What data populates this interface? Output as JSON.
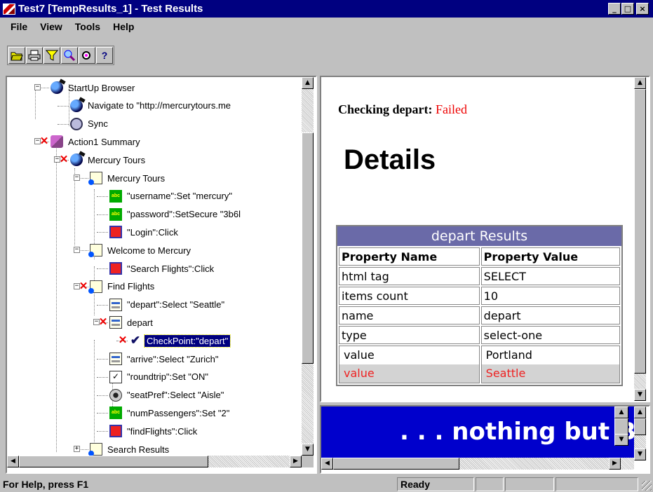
{
  "window": {
    "title": "Test7 [TempResults_1] - Test Results",
    "minimize": "_",
    "restore": "□",
    "close": "×"
  },
  "menu": [
    "File",
    "View",
    "Tools",
    "Help"
  ],
  "toolbar": {
    "help_label": "?",
    "icons": [
      "open-icon",
      "print-icon",
      "filter-icon",
      "find-icon",
      "goto-icon",
      "help-icon"
    ]
  },
  "tree": [
    {
      "label": "StartUp Browser",
      "icon": "globe",
      "level": 0,
      "expander": "−",
      "failed": false
    },
    {
      "label": "Navigate to  \"http://mercurytours.me",
      "icon": "globe",
      "level": 1,
      "failed": false
    },
    {
      "label": "Sync",
      "icon": "sync",
      "level": 1,
      "failed": false
    },
    {
      "label": "Action1 Summary",
      "icon": "action",
      "level": 0,
      "expander": "−",
      "failed": true
    },
    {
      "label": "Mercury Tours",
      "icon": "globe",
      "level": 1,
      "expander": "−",
      "failed": true
    },
    {
      "label": "Mercury Tours",
      "icon": "page",
      "level": 2,
      "expander": "−",
      "failed": false
    },
    {
      "label": "\"username\":Set \"mercury\"",
      "icon": "edit",
      "level": 3,
      "failed": false
    },
    {
      "label": "\"password\":SetSecure \"3b6l",
      "icon": "edit",
      "level": 3,
      "failed": false
    },
    {
      "label": "\"Login\":Click",
      "icon": "btn",
      "level": 3,
      "failed": false
    },
    {
      "label": "Welcome to Mercury",
      "icon": "page",
      "level": 2,
      "expander": "−",
      "failed": false
    },
    {
      "label": "\"Search Flights\":Click",
      "icon": "btn",
      "level": 3,
      "failed": false
    },
    {
      "label": "Find Flights",
      "icon": "page",
      "level": 2,
      "expander": "−",
      "failed": true
    },
    {
      "label": "\"depart\":Select \"Seattle\"",
      "icon": "list",
      "level": 3,
      "failed": false
    },
    {
      "label": "depart",
      "icon": "list",
      "level": 3,
      "expander": "−",
      "failed": true
    },
    {
      "label": "CheckPoint:\"depart\"",
      "icon": "check",
      "level": 4,
      "failed": true,
      "selected": true
    },
    {
      "label": "\"arrive\":Select \"Zurich\"",
      "icon": "list",
      "level": 3,
      "failed": false
    },
    {
      "label": "\"roundtrip\":Set \"ON\"",
      "icon": "checkbox",
      "level": 3,
      "failed": false
    },
    {
      "label": "\"seatPref\":Select \"Aisle\"",
      "icon": "radio",
      "level": 3,
      "failed": false
    },
    {
      "label": "\"numPassengers\":Set \"2\"",
      "icon": "edit",
      "level": 3,
      "failed": false
    },
    {
      "label": "\"findFlights\":Click",
      "icon": "btn",
      "level": 3,
      "failed": false
    },
    {
      "label": "Search Results",
      "icon": "page",
      "level": 2,
      "expander": "+",
      "failed": false
    }
  ],
  "details": {
    "checking_label": "Checking depart",
    "colon": ": ",
    "status": "Failed",
    "heading": "Details",
    "table_caption": "depart Results",
    "col_name": "Property Name",
    "col_value": "Property Value",
    "rows": [
      {
        "name": "html tag",
        "value": "SELECT"
      },
      {
        "name": "items count",
        "value": "10"
      },
      {
        "name": "name",
        "value": "depart"
      },
      {
        "name": "type",
        "value": "select-one"
      }
    ],
    "value_expected": {
      "name": "value",
      "value": "Portland"
    },
    "value_actual": {
      "name": "value",
      "value": "Seattle"
    }
  },
  "banner": {
    "text": ". . . nothing but Blu"
  },
  "statusbar": {
    "help": "For Help, press F1",
    "state": "Ready"
  },
  "colors": {
    "title_bar": "#000080",
    "selection": "#000080",
    "failed": "#e00000",
    "banner_bg": "#0000cc",
    "table_caption_bg": "#6a6aa8"
  }
}
